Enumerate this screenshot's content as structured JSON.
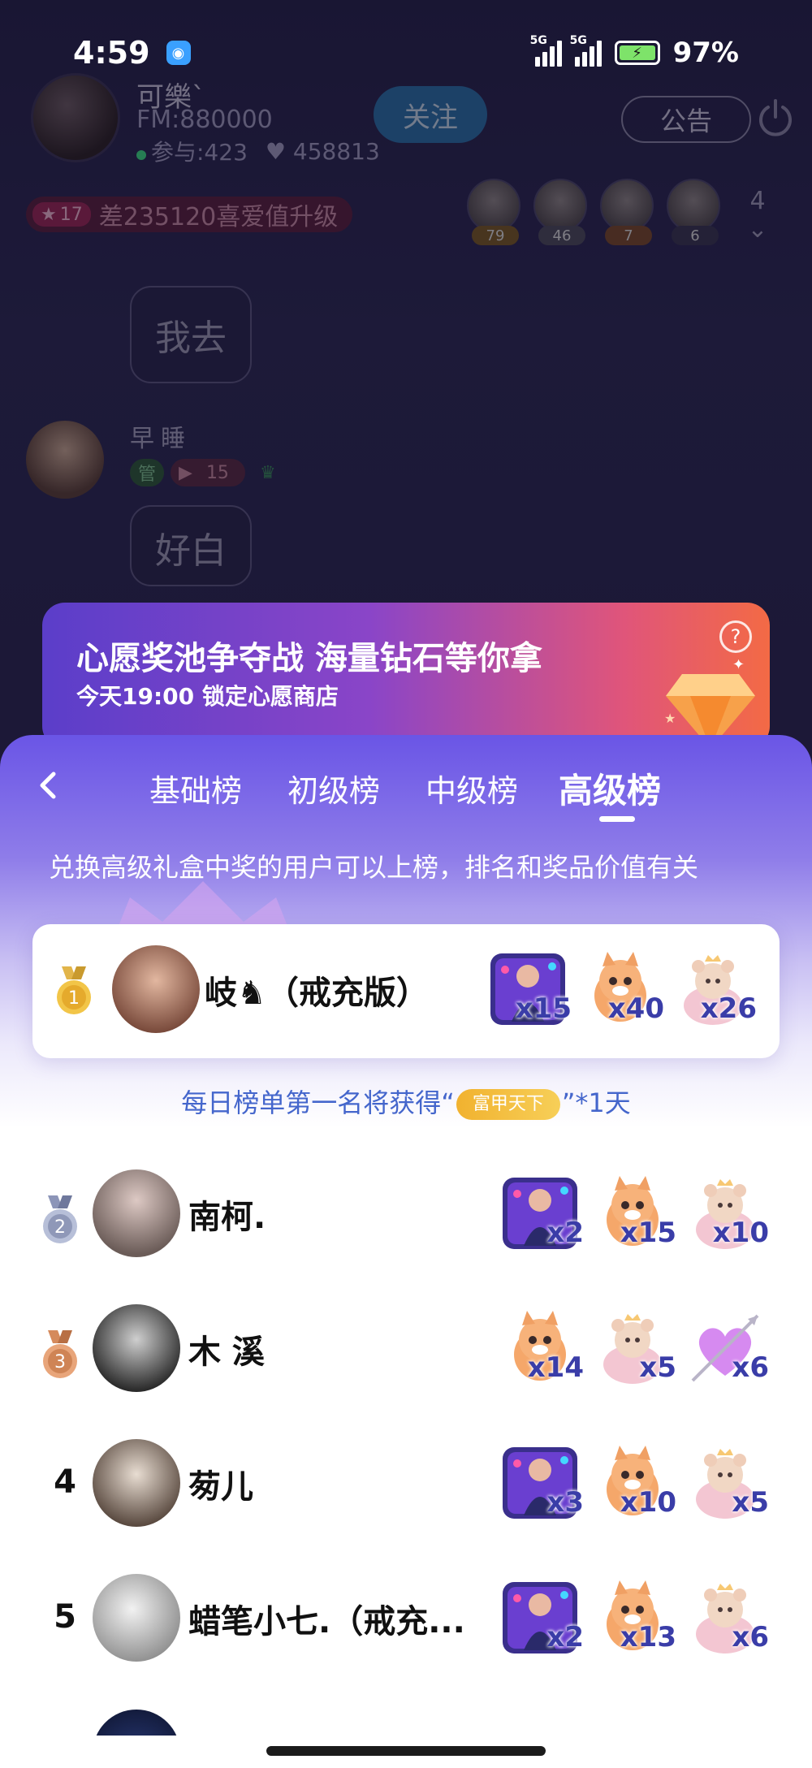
{
  "status_bar": {
    "time": "4:59",
    "net1": "5G",
    "net2": "5G",
    "battery": "97%"
  },
  "room": {
    "host_name": "可樂`",
    "fm": "FM:880000",
    "participants": "参与:423",
    "hearts": "458813",
    "follow_label": "关注",
    "notice_label": "公告",
    "level": "17",
    "level_text": "差235120喜爱值升级",
    "viewers": [
      {
        "count": "79",
        "color": "#7a5a26"
      },
      {
        "count": "46",
        "color": "#4e4b5c"
      },
      {
        "count": "7",
        "color": "#7a4a2a"
      },
      {
        "count": "6",
        "color": "#3a3650"
      }
    ],
    "viewer_more": "4",
    "chat_messages": [
      "我去",
      "好白"
    ],
    "chat_user_name": "早睡",
    "chat_user_badge1": "管",
    "chat_user_badge2": "15"
  },
  "promo": {
    "title": "心愿奖池争夺战 海量钻石等你拿",
    "subtitle": "今天19:00 锁定心愿商店",
    "help": "?"
  },
  "sheet": {
    "tabs": [
      "基础榜",
      "初级榜",
      "中级榜",
      "高级榜"
    ],
    "active_tab": 3,
    "description": "兑换高级礼盒中奖的用户可以上榜，排名和奖品价值有关",
    "reward_prefix": "每日榜单第一名将获得“",
    "reward_badge": "富甲天下",
    "reward_suffix": "”*1天",
    "first": {
      "rank": "1",
      "name": "岐♞（戒充版）",
      "prizes": [
        {
          "icon": "dj-girl-gift",
          "qty": "x15"
        },
        {
          "icon": "kitten-gift",
          "qty": "x40"
        },
        {
          "icon": "angel-bear-gift",
          "qty": "x26"
        }
      ]
    },
    "ranks": [
      {
        "rank": "2",
        "name": "南柯.",
        "avatar": "#9a8a86",
        "prizes": [
          {
            "icon": "dj-girl-gift",
            "qty": "x2"
          },
          {
            "icon": "kitten-gift",
            "qty": "x15"
          },
          {
            "icon": "angel-bear-gift",
            "qty": "x10"
          }
        ]
      },
      {
        "rank": "3",
        "name": "木 溪",
        "avatar": "#6b6b6b",
        "prizes": [
          {
            "icon": "kitten-gift",
            "qty": "x14"
          },
          {
            "icon": "angel-bear-gift",
            "qty": "x5"
          },
          {
            "icon": "heart-arrow-gift",
            "qty": "x6"
          }
        ]
      },
      {
        "rank": "4",
        "name": "茐儿",
        "avatar": "#c9b7a8",
        "prizes": [
          {
            "icon": "dj-girl-gift",
            "qty": "x3"
          },
          {
            "icon": "kitten-gift",
            "qty": "x10"
          },
          {
            "icon": "angel-bear-gift",
            "qty": "x5"
          }
        ]
      },
      {
        "rank": "5",
        "name": "蜡笔小七.（戒充...",
        "avatar": "#d8d8d8",
        "prizes": [
          {
            "icon": "dj-girl-gift",
            "qty": "x2"
          },
          {
            "icon": "kitten-gift",
            "qty": "x13"
          },
          {
            "icon": "angel-bear-gift",
            "qty": "x6"
          }
        ]
      }
    ]
  }
}
